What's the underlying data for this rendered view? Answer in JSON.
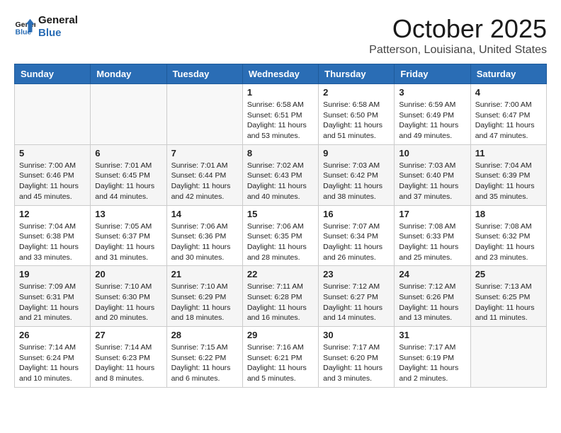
{
  "header": {
    "logo_line1": "General",
    "logo_line2": "Blue",
    "month": "October 2025",
    "location": "Patterson, Louisiana, United States"
  },
  "weekdays": [
    "Sunday",
    "Monday",
    "Tuesday",
    "Wednesday",
    "Thursday",
    "Friday",
    "Saturday"
  ],
  "weeks": [
    [
      {
        "day": "",
        "info": ""
      },
      {
        "day": "",
        "info": ""
      },
      {
        "day": "",
        "info": ""
      },
      {
        "day": "1",
        "info": "Sunrise: 6:58 AM\nSunset: 6:51 PM\nDaylight: 11 hours and 53 minutes."
      },
      {
        "day": "2",
        "info": "Sunrise: 6:58 AM\nSunset: 6:50 PM\nDaylight: 11 hours and 51 minutes."
      },
      {
        "day": "3",
        "info": "Sunrise: 6:59 AM\nSunset: 6:49 PM\nDaylight: 11 hours and 49 minutes."
      },
      {
        "day": "4",
        "info": "Sunrise: 7:00 AM\nSunset: 6:47 PM\nDaylight: 11 hours and 47 minutes."
      }
    ],
    [
      {
        "day": "5",
        "info": "Sunrise: 7:00 AM\nSunset: 6:46 PM\nDaylight: 11 hours and 45 minutes."
      },
      {
        "day": "6",
        "info": "Sunrise: 7:01 AM\nSunset: 6:45 PM\nDaylight: 11 hours and 44 minutes."
      },
      {
        "day": "7",
        "info": "Sunrise: 7:01 AM\nSunset: 6:44 PM\nDaylight: 11 hours and 42 minutes."
      },
      {
        "day": "8",
        "info": "Sunrise: 7:02 AM\nSunset: 6:43 PM\nDaylight: 11 hours and 40 minutes."
      },
      {
        "day": "9",
        "info": "Sunrise: 7:03 AM\nSunset: 6:42 PM\nDaylight: 11 hours and 38 minutes."
      },
      {
        "day": "10",
        "info": "Sunrise: 7:03 AM\nSunset: 6:40 PM\nDaylight: 11 hours and 37 minutes."
      },
      {
        "day": "11",
        "info": "Sunrise: 7:04 AM\nSunset: 6:39 PM\nDaylight: 11 hours and 35 minutes."
      }
    ],
    [
      {
        "day": "12",
        "info": "Sunrise: 7:04 AM\nSunset: 6:38 PM\nDaylight: 11 hours and 33 minutes."
      },
      {
        "day": "13",
        "info": "Sunrise: 7:05 AM\nSunset: 6:37 PM\nDaylight: 11 hours and 31 minutes."
      },
      {
        "day": "14",
        "info": "Sunrise: 7:06 AM\nSunset: 6:36 PM\nDaylight: 11 hours and 30 minutes."
      },
      {
        "day": "15",
        "info": "Sunrise: 7:06 AM\nSunset: 6:35 PM\nDaylight: 11 hours and 28 minutes."
      },
      {
        "day": "16",
        "info": "Sunrise: 7:07 AM\nSunset: 6:34 PM\nDaylight: 11 hours and 26 minutes."
      },
      {
        "day": "17",
        "info": "Sunrise: 7:08 AM\nSunset: 6:33 PM\nDaylight: 11 hours and 25 minutes."
      },
      {
        "day": "18",
        "info": "Sunrise: 7:08 AM\nSunset: 6:32 PM\nDaylight: 11 hours and 23 minutes."
      }
    ],
    [
      {
        "day": "19",
        "info": "Sunrise: 7:09 AM\nSunset: 6:31 PM\nDaylight: 11 hours and 21 minutes."
      },
      {
        "day": "20",
        "info": "Sunrise: 7:10 AM\nSunset: 6:30 PM\nDaylight: 11 hours and 20 minutes."
      },
      {
        "day": "21",
        "info": "Sunrise: 7:10 AM\nSunset: 6:29 PM\nDaylight: 11 hours and 18 minutes."
      },
      {
        "day": "22",
        "info": "Sunrise: 7:11 AM\nSunset: 6:28 PM\nDaylight: 11 hours and 16 minutes."
      },
      {
        "day": "23",
        "info": "Sunrise: 7:12 AM\nSunset: 6:27 PM\nDaylight: 11 hours and 14 minutes."
      },
      {
        "day": "24",
        "info": "Sunrise: 7:12 AM\nSunset: 6:26 PM\nDaylight: 11 hours and 13 minutes."
      },
      {
        "day": "25",
        "info": "Sunrise: 7:13 AM\nSunset: 6:25 PM\nDaylight: 11 hours and 11 minutes."
      }
    ],
    [
      {
        "day": "26",
        "info": "Sunrise: 7:14 AM\nSunset: 6:24 PM\nDaylight: 11 hours and 10 minutes."
      },
      {
        "day": "27",
        "info": "Sunrise: 7:14 AM\nSunset: 6:23 PM\nDaylight: 11 hours and 8 minutes."
      },
      {
        "day": "28",
        "info": "Sunrise: 7:15 AM\nSunset: 6:22 PM\nDaylight: 11 hours and 6 minutes."
      },
      {
        "day": "29",
        "info": "Sunrise: 7:16 AM\nSunset: 6:21 PM\nDaylight: 11 hours and 5 minutes."
      },
      {
        "day": "30",
        "info": "Sunrise: 7:17 AM\nSunset: 6:20 PM\nDaylight: 11 hours and 3 minutes."
      },
      {
        "day": "31",
        "info": "Sunrise: 7:17 AM\nSunset: 6:19 PM\nDaylight: 11 hours and 2 minutes."
      },
      {
        "day": "",
        "info": ""
      }
    ]
  ]
}
